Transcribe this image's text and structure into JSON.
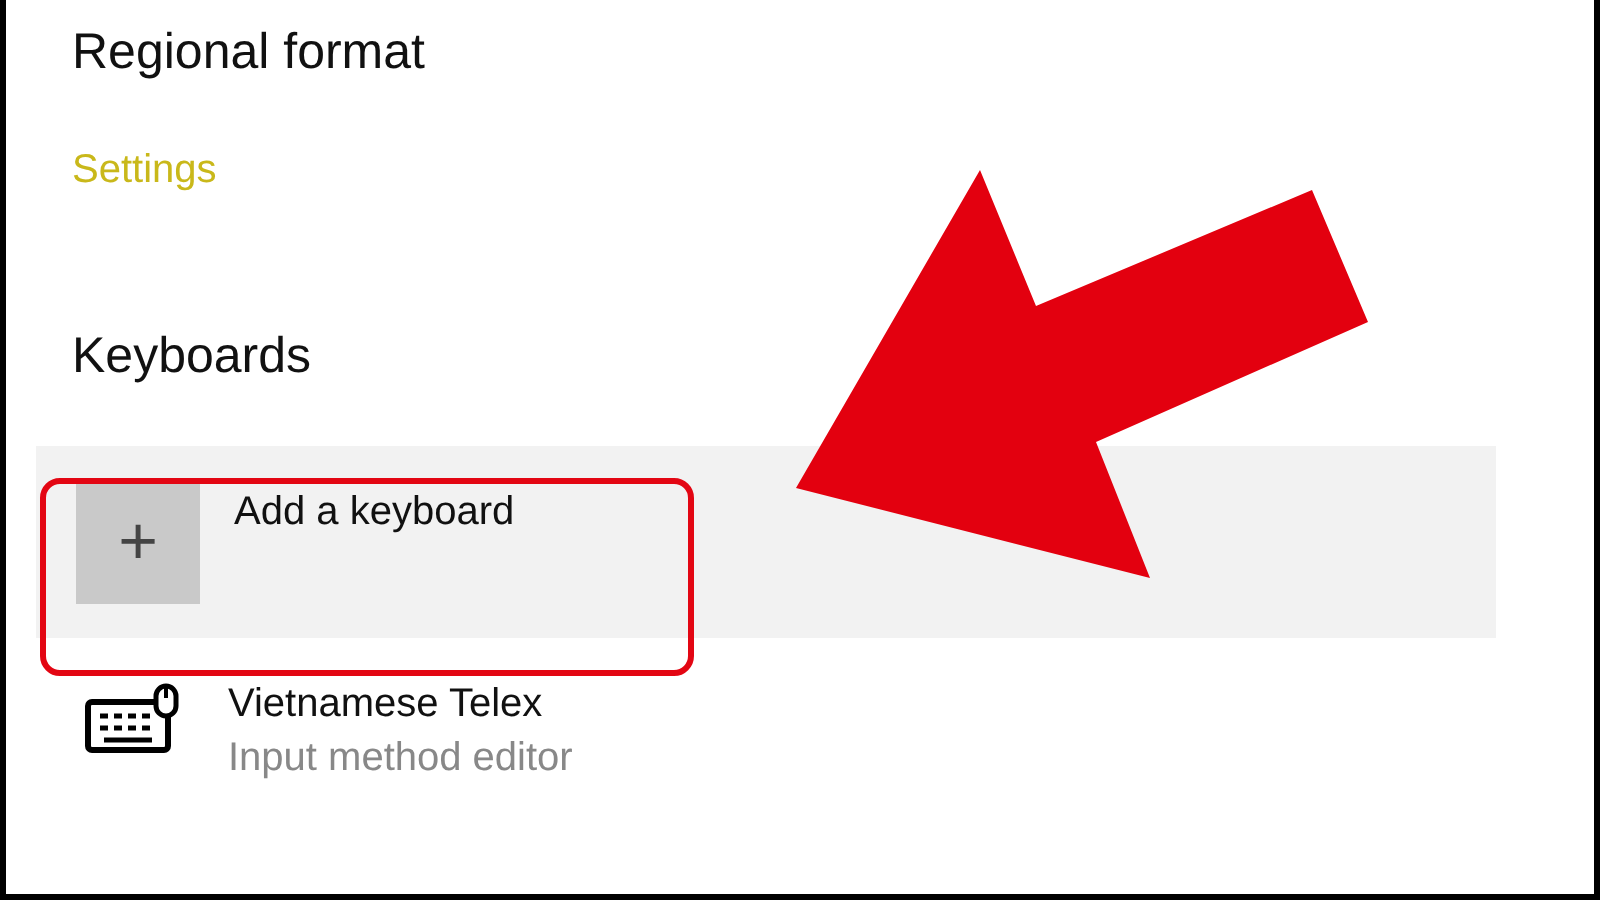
{
  "section_title": "Regional format",
  "settings_link": "Settings",
  "keyboards_title": "Keyboards",
  "add_keyboard": {
    "label": "Add a keyboard",
    "plus": "+",
    "highlighted": true
  },
  "keyboards": [
    {
      "name": "Vietnamese Telex",
      "description": "Input method editor"
    }
  ]
}
